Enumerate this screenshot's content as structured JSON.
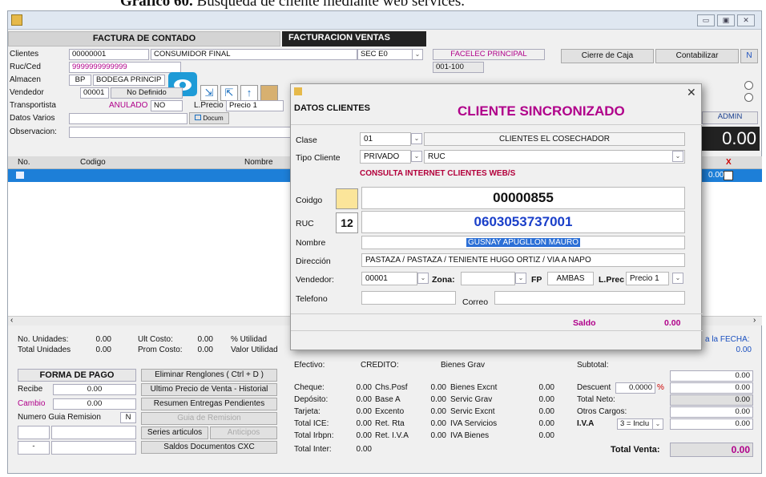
{
  "caption": {
    "prefix": "Gráfico 60.",
    "text": " Búsqueda de cliente mediante web services."
  },
  "header": {
    "factura": "FACTURA DE CONTADO",
    "facturacion": "FACTURACION VENTAS"
  },
  "form": {
    "clientes_label": "Clientes",
    "clientes_code": "00000001",
    "clientes_name": "CONSUMIDOR FINAL",
    "ruc_label": "Ruc/Ced",
    "ruc_value": "9999999999999",
    "almacen_label": "Almacen",
    "almacen_code": "BP",
    "almacen_name": "BODEGA PRINCIP",
    "vendedor_label": "Vendedor",
    "vendedor_code": "00001",
    "vendedor_name": "No Definido",
    "transportista_label": "Transportista",
    "anulado_label": "ANULADO",
    "anulado_value": "NO",
    "lprecio_label": "L.Precio",
    "lprecio_value": "Precio 1",
    "datos_label": "Datos Varios",
    "docum_label": "Docum",
    "observacion_label": "Observacion:",
    "sec_value": "SEC E0",
    "facelec": "FACELEC PRINCIPAL",
    "serie": "001-100",
    "cierre_caja": "Cierre de Caja",
    "contabilizar": "Contabilizar",
    "n_flag": "N",
    "admin": "ADMIN",
    "total_display": "0.00"
  },
  "grid": {
    "col_no": "No.",
    "col_codigo": "Codigo",
    "col_nombre": "Nombre",
    "col_x": "X",
    "row_value": "0.00"
  },
  "dialog": {
    "section": "DATOS CLIENTES",
    "status": "CLIENTE SINCRONIZADO",
    "clase_label": "Clase",
    "clase_code": "01",
    "clase_name": "CLIENTES EL COSECHADOR",
    "tipo_label": "Tipo Cliente",
    "tipo_value": "PRIVADO",
    "tipo_doc": "RUC",
    "consulta": "CONSULTA INTERNET CLIENTES WEB/S",
    "codigo_label": "Coidgo",
    "codigo_value": "00000855",
    "ruc_label": "RUC",
    "ruc_value": "0603053737001",
    "nombre_label": "Nombre",
    "nombre_value": "GUSÑAY APUGLLON MAURO",
    "direccion_label": "Dirección",
    "direccion_value": "PASTAZA / PASTAZA / TENIENTE HUGO ORTIZ / VIA A NAPO",
    "vendedor_label": "Vendedor:",
    "vendedor_value": "00001",
    "zona_label": "Zona:",
    "fp_label": "FP",
    "fp_value": "AMBAS",
    "lprec_label": "L.Prec",
    "lprec_value": "Precio 1",
    "telefono_label": "Telefono",
    "correo_label": "Correo",
    "saldo_label": "Saldo",
    "saldo_value": "0.00"
  },
  "stats": {
    "unidades_label": "No. Unidades:",
    "unidades_value": "0.00",
    "total_unidades_label": "Total Unidades",
    "total_unidades_value": "0.00",
    "ult_costo_label": "Ult Costo:",
    "ult_costo_value": "0.00",
    "prom_costo_label": "Prom Costo:",
    "prom_costo_value": "0.00",
    "utilidad_label": "% Utilidad",
    "valor_utilidad_label": "Valor Utilidad",
    "fecha_label": "a la FECHA:",
    "fecha_value": "0.00"
  },
  "payment": {
    "forma_pago": "FORMA DE PAGO",
    "recibe_label": "Recibe",
    "recibe_value": "0.00",
    "cambio_label": "Cambio",
    "cambio_value": "0.00",
    "guia_label": "Numero Guia Remision",
    "guia_flag": "N",
    "dash": "-",
    "eliminar": "Eliminar Renglones ( Ctrl + D )",
    "ultimo_precio": "Ultimo Precio de Venta - Historial",
    "resumen": "Resumen Entregas Pendientes",
    "guia_btn": "Guia de Remision",
    "series": "Series articulos",
    "anticipos": "Anticipos",
    "saldos": "Saldos Documentos CXC"
  },
  "totals": {
    "efectivo_label": "Efectivo:",
    "credito_label": "CREDITO:",
    "bienes_grav_label": "Bienes Grav",
    "subtotal_label": "Subtotal:",
    "cheque_label": "Cheque:",
    "cheque_value": "0.00",
    "chs_posf_label": "Chs.Posf",
    "chs_posf_value": "0.00",
    "bienes_excnt_label": "Bienes Excnt",
    "bienes_excnt_value": "0.00",
    "descuent_label": "Descuent",
    "descuent_pct": "0.0000",
    "pct_sign": "%",
    "descuent_value": "0.00",
    "deposito_label": "Depósito:",
    "deposito_value": "0.00",
    "base_a_label": "Base A",
    "base_a_value": "0.00",
    "servic_grav_label": "Servic Grav",
    "servic_grav_value": "0.00",
    "total_neto_label": "Total Neto:",
    "total_neto_value": "0.00",
    "tarjeta_label": "Tarjeta:",
    "tarjeta_value": "0.00",
    "excento_label": "Excento",
    "excento_value": "0.00",
    "servic_excnt_label": "Servic Excnt",
    "servic_excnt_value": "0.00",
    "otros_label": "Otros Cargos:",
    "otros_value": "0.00",
    "ice_label": "Total ICE:",
    "ice_value": "0.00",
    "ret_rta_label": "Ret. Rta",
    "ret_rta_value": "0.00",
    "iva_serv_label": "IVA Servicios",
    "iva_serv_value": "0.00",
    "iva_label": "I.V.A",
    "iva_select": "3 = Inclu",
    "iva_value": "0.00",
    "irbpn_label": "Total Irbpn:",
    "irbpn_value": "0.00",
    "ret_iva_label": "Ret. I.V.A",
    "ret_iva_value": "0.00",
    "iva_bienes_label": "IVA Bienes",
    "iva_bienes_value": "0.00",
    "inter_label": "Total Inter:",
    "inter_value": "0.00",
    "total_venta_label": "Total Venta:",
    "total_venta_value": "0.00",
    "row0_value": "0.00"
  }
}
